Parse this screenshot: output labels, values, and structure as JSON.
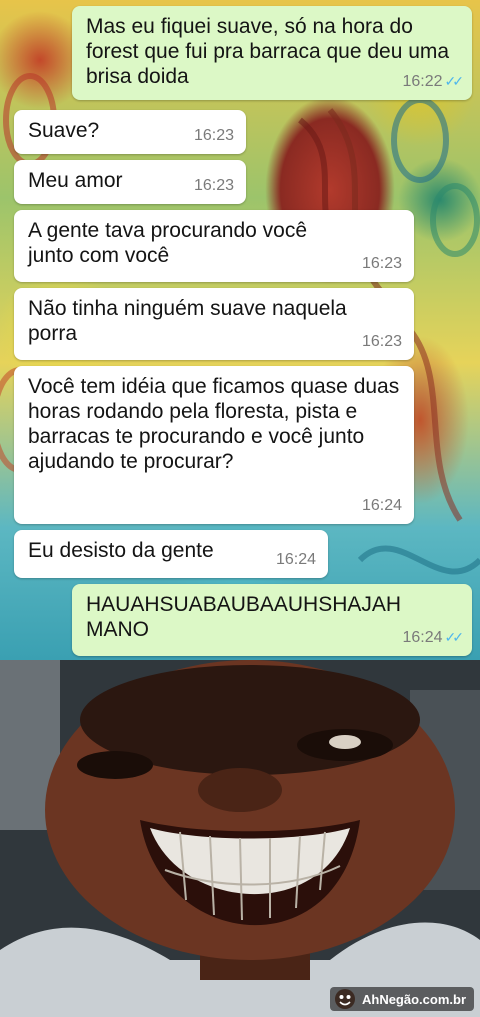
{
  "messages": [
    {
      "direction": "outgoing",
      "text": "Mas eu fiquei suave, só na hora do forest que fui pra barraca que deu uma brisa doida",
      "time": "16:22",
      "status": "read"
    },
    {
      "direction": "incoming",
      "text": "Suave?",
      "time": "16:23"
    },
    {
      "direction": "incoming",
      "text": "Meu amor",
      "time": "16:23"
    },
    {
      "direction": "incoming",
      "text": "A gente tava procurando você junto com você",
      "time": "16:23"
    },
    {
      "direction": "incoming",
      "text": "Não tinha ninguém suave naquela porra",
      "time": "16:23"
    },
    {
      "direction": "incoming",
      "text": "Você tem idéia que ficamos quase duas horas rodando pela floresta, pista e barracas te procurando e você junto ajudando te procurar?",
      "time": "16:24"
    },
    {
      "direction": "incoming",
      "text": "Eu desisto da gente",
      "time": "16:24"
    },
    {
      "direction": "outgoing",
      "text": "HAUAHSUABAUBAAUHSHAJAH MANO",
      "time": "16:24",
      "status": "read"
    }
  ],
  "ticks_glyph": "✓✓",
  "watermark": {
    "text": "AhNegão.com.br"
  },
  "colors": {
    "incoming": "#ffffff",
    "outgoing": "#dcf8c6",
    "read_ticks": "#4fb6ec"
  }
}
